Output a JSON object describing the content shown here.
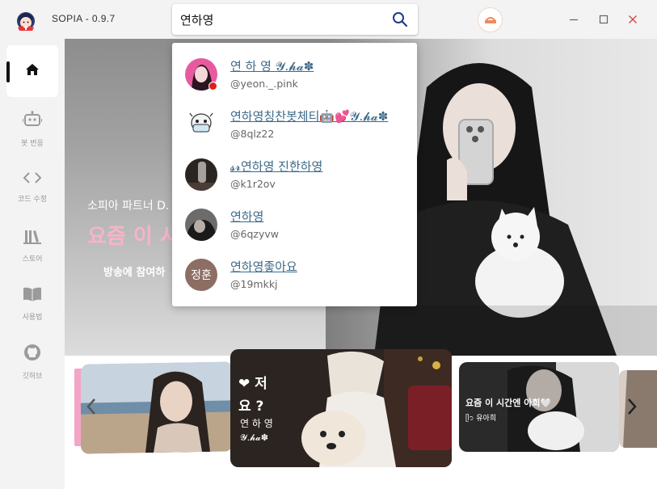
{
  "window": {
    "title": "SOPIA - 0.9.7",
    "controls": [
      "minimize",
      "maximize",
      "close"
    ]
  },
  "search": {
    "query": "연하영",
    "placeholder": ""
  },
  "user_avatar": {
    "text": "SOPIA"
  },
  "sidebar": {
    "items": [
      {
        "label": "",
        "icon": "home-icon",
        "active": true
      },
      {
        "label": "봇 번응",
        "icon": "robot-icon"
      },
      {
        "label": "코드 수정",
        "icon": "code-icon"
      },
      {
        "label": "스토어",
        "icon": "library-icon"
      },
      {
        "label": "사용법",
        "icon": "book-icon"
      },
      {
        "label": "깃허브",
        "icon": "github-icon"
      }
    ]
  },
  "hero": {
    "subtitle": "소피아 파트너 D.",
    "title": "요즘 이 시",
    "button": "방송에 참여하"
  },
  "search_results": [
    {
      "name": "연 하 영 𝓨.𝓱𝓪✽",
      "handle": "@yeon._.pink",
      "avatar": "photo-pink"
    },
    {
      "name": "연하영칭찬봇체티🤖💕𝓨.𝓱𝓪✽",
      "handle": "@8qlz22",
      "avatar": "robot-avatar"
    },
    {
      "name": "𝓼𝓻연하영 진한하영",
      "handle": "@k1r2ov",
      "avatar": "photo-dark"
    },
    {
      "name": "연하영",
      "handle": "@6qzyvw",
      "avatar": "photo-gray"
    },
    {
      "name": "연하영좋아요",
      "handle": "@19mkkj",
      "avatar": "text-avatar",
      "avatar_text": "정훈"
    }
  ],
  "carousel": {
    "cards": [
      {
        "title": "",
        "subtitle": ""
      },
      {
        "title": "❤저요?",
        "line1": "❤ 저",
        "line2": "요 ?",
        "line3": "연 하 영",
        "line4": "𝓨.𝓱𝓪✽"
      },
      {
        "title": "요즘 이 시간엔 아희🤍",
        "subtitle": "ᥫ᭡ 유아희"
      },
      {
        "title": "",
        "subtitle": ""
      }
    ]
  },
  "colors": {
    "accent": "#f6b4c8",
    "link": "#3d6a8a",
    "close_red": "#e04343",
    "status_dot": "#e02020"
  }
}
